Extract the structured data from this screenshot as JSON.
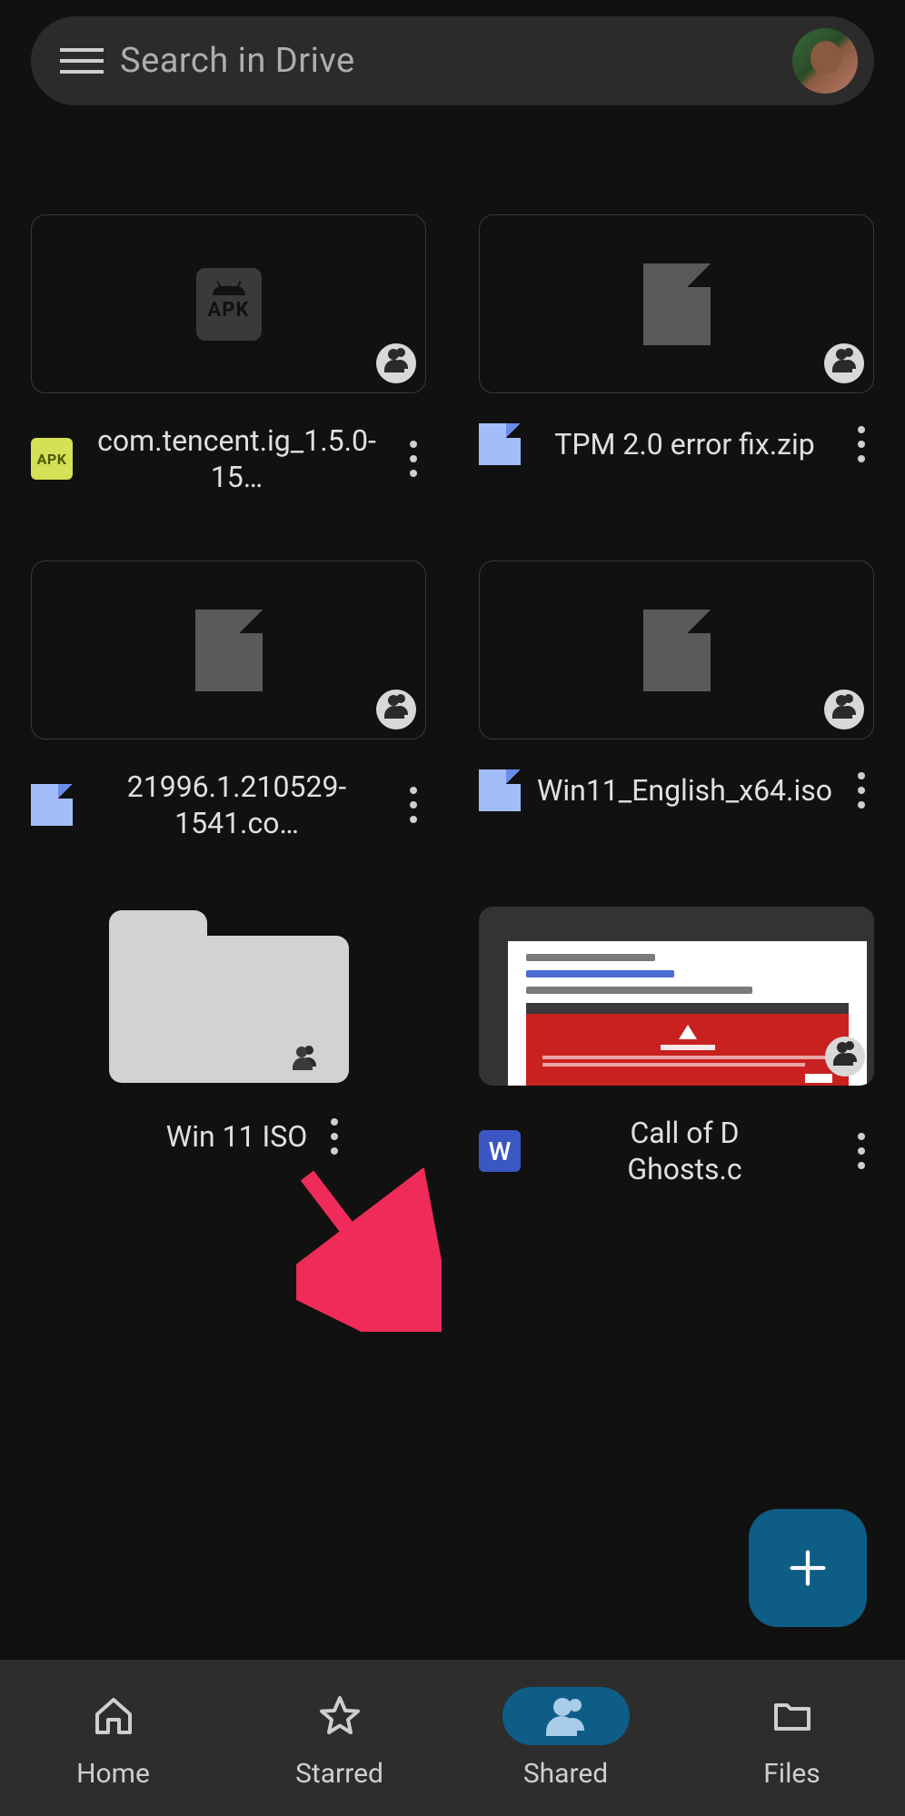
{
  "search": {
    "placeholder": "Search in Drive"
  },
  "files": [
    {
      "name": "com.tencent.ig_1.5.0-15…",
      "type_label": "APK"
    },
    {
      "name": "TPM 2.0 error fix.zip"
    },
    {
      "name": "21996.1.210529-1541.co…"
    },
    {
      "name": "Win11_English_x64.iso"
    },
    {
      "name": "Win 11 ISO"
    },
    {
      "name": "Call of D\nGhosts.c",
      "type_label": "W"
    }
  ],
  "nav": {
    "home": "Home",
    "starred": "Starred",
    "shared": "Shared",
    "files": "Files"
  }
}
